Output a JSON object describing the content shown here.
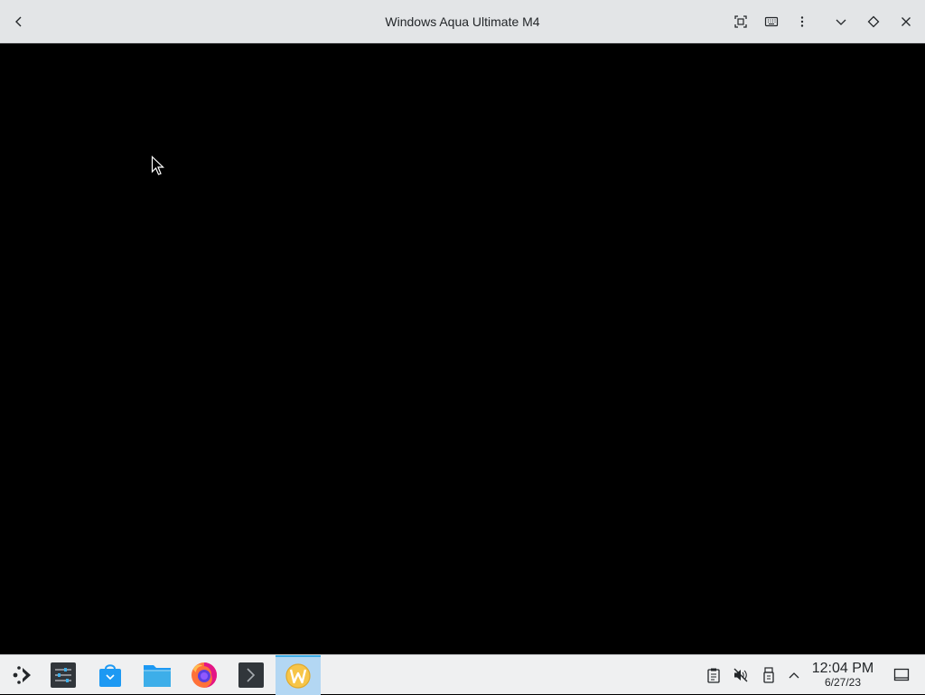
{
  "window": {
    "title": "Windows Aqua Ultimate M4",
    "buttons": [
      "back-icon",
      "fullscreen-icon",
      "keyboard-icon",
      "menu-icon",
      "minimize-icon",
      "maximize-icon",
      "close-icon"
    ]
  },
  "taskbar": {
    "apps": [
      {
        "name": "application-launcher",
        "icon": "kde-launcher-icon"
      },
      {
        "name": "system-settings",
        "icon": "settings-sliders-icon"
      },
      {
        "name": "discover",
        "icon": "store-bag-icon"
      },
      {
        "name": "dolphin",
        "icon": "folder-icon"
      },
      {
        "name": "firefox",
        "icon": "firefox-icon"
      },
      {
        "name": "konsole",
        "icon": "terminal-icon"
      },
      {
        "name": "winaqua",
        "icon": "w-app-icon",
        "active": true
      }
    ],
    "tray": [
      "clipboard-icon",
      "volume-muted-icon",
      "usb-device-icon",
      "expand-tray-icon"
    ],
    "clock": {
      "time": "12:04 PM",
      "date": "6/27/23"
    }
  },
  "colors": {
    "titlebar_bg": "#e3e5e7",
    "viewport_bg": "#000000",
    "taskbar_bg": "#eff0f1",
    "active_task": "#b3d7f3",
    "accent": "#3daee9"
  }
}
